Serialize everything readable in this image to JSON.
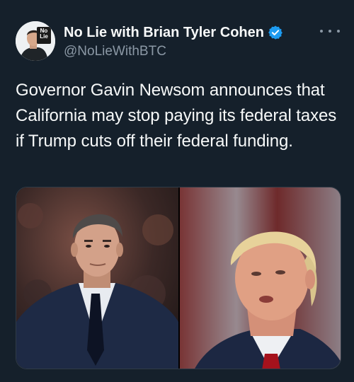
{
  "author": {
    "display_name": "No Lie with Brian Tyler Cohen",
    "handle": "@NoLieWithBTC",
    "avatar_logo_line1": "No",
    "avatar_logo_line2": "Lie",
    "verified": true
  },
  "tweet": {
    "text": "Governor Gavin Newsom announces that California may stop paying its federal taxes if Trump cuts off their federal funding."
  },
  "media": {
    "images": [
      {
        "subject": "man in dark suit with white shirt and black tie"
      },
      {
        "subject": "older man with blond hair, dark suit and red tie"
      }
    ]
  },
  "colors": {
    "background": "#15202b",
    "text": "#f7f9f9",
    "muted": "#8b98a5",
    "verified": "#1d9bf0"
  }
}
